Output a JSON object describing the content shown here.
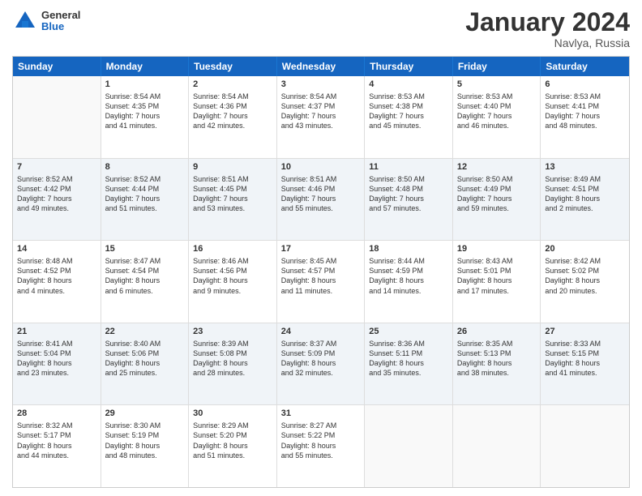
{
  "header": {
    "logo": {
      "general": "General",
      "blue": "Blue"
    },
    "title": "January 2024",
    "subtitle": "Navlya, Russia"
  },
  "calendar": {
    "days": [
      "Sunday",
      "Monday",
      "Tuesday",
      "Wednesday",
      "Thursday",
      "Friday",
      "Saturday"
    ],
    "rows": [
      [
        {
          "day": "",
          "lines": [],
          "empty": true
        },
        {
          "day": "1",
          "lines": [
            "Sunrise: 8:54 AM",
            "Sunset: 4:35 PM",
            "Daylight: 7 hours",
            "and 41 minutes."
          ]
        },
        {
          "day": "2",
          "lines": [
            "Sunrise: 8:54 AM",
            "Sunset: 4:36 PM",
            "Daylight: 7 hours",
            "and 42 minutes."
          ]
        },
        {
          "day": "3",
          "lines": [
            "Sunrise: 8:54 AM",
            "Sunset: 4:37 PM",
            "Daylight: 7 hours",
            "and 43 minutes."
          ]
        },
        {
          "day": "4",
          "lines": [
            "Sunrise: 8:53 AM",
            "Sunset: 4:38 PM",
            "Daylight: 7 hours",
            "and 45 minutes."
          ]
        },
        {
          "day": "5",
          "lines": [
            "Sunrise: 8:53 AM",
            "Sunset: 4:40 PM",
            "Daylight: 7 hours",
            "and 46 minutes."
          ]
        },
        {
          "day": "6",
          "lines": [
            "Sunrise: 8:53 AM",
            "Sunset: 4:41 PM",
            "Daylight: 7 hours",
            "and 48 minutes."
          ]
        }
      ],
      [
        {
          "day": "7",
          "lines": [
            "Sunrise: 8:52 AM",
            "Sunset: 4:42 PM",
            "Daylight: 7 hours",
            "and 49 minutes."
          ]
        },
        {
          "day": "8",
          "lines": [
            "Sunrise: 8:52 AM",
            "Sunset: 4:44 PM",
            "Daylight: 7 hours",
            "and 51 minutes."
          ]
        },
        {
          "day": "9",
          "lines": [
            "Sunrise: 8:51 AM",
            "Sunset: 4:45 PM",
            "Daylight: 7 hours",
            "and 53 minutes."
          ]
        },
        {
          "day": "10",
          "lines": [
            "Sunrise: 8:51 AM",
            "Sunset: 4:46 PM",
            "Daylight: 7 hours",
            "and 55 minutes."
          ]
        },
        {
          "day": "11",
          "lines": [
            "Sunrise: 8:50 AM",
            "Sunset: 4:48 PM",
            "Daylight: 7 hours",
            "and 57 minutes."
          ]
        },
        {
          "day": "12",
          "lines": [
            "Sunrise: 8:50 AM",
            "Sunset: 4:49 PM",
            "Daylight: 7 hours",
            "and 59 minutes."
          ]
        },
        {
          "day": "13",
          "lines": [
            "Sunrise: 8:49 AM",
            "Sunset: 4:51 PM",
            "Daylight: 8 hours",
            "and 2 minutes."
          ]
        }
      ],
      [
        {
          "day": "14",
          "lines": [
            "Sunrise: 8:48 AM",
            "Sunset: 4:52 PM",
            "Daylight: 8 hours",
            "and 4 minutes."
          ]
        },
        {
          "day": "15",
          "lines": [
            "Sunrise: 8:47 AM",
            "Sunset: 4:54 PM",
            "Daylight: 8 hours",
            "and 6 minutes."
          ]
        },
        {
          "day": "16",
          "lines": [
            "Sunrise: 8:46 AM",
            "Sunset: 4:56 PM",
            "Daylight: 8 hours",
            "and 9 minutes."
          ]
        },
        {
          "day": "17",
          "lines": [
            "Sunrise: 8:45 AM",
            "Sunset: 4:57 PM",
            "Daylight: 8 hours",
            "and 11 minutes."
          ]
        },
        {
          "day": "18",
          "lines": [
            "Sunrise: 8:44 AM",
            "Sunset: 4:59 PM",
            "Daylight: 8 hours",
            "and 14 minutes."
          ]
        },
        {
          "day": "19",
          "lines": [
            "Sunrise: 8:43 AM",
            "Sunset: 5:01 PM",
            "Daylight: 8 hours",
            "and 17 minutes."
          ]
        },
        {
          "day": "20",
          "lines": [
            "Sunrise: 8:42 AM",
            "Sunset: 5:02 PM",
            "Daylight: 8 hours",
            "and 20 minutes."
          ]
        }
      ],
      [
        {
          "day": "21",
          "lines": [
            "Sunrise: 8:41 AM",
            "Sunset: 5:04 PM",
            "Daylight: 8 hours",
            "and 23 minutes."
          ]
        },
        {
          "day": "22",
          "lines": [
            "Sunrise: 8:40 AM",
            "Sunset: 5:06 PM",
            "Daylight: 8 hours",
            "and 25 minutes."
          ]
        },
        {
          "day": "23",
          "lines": [
            "Sunrise: 8:39 AM",
            "Sunset: 5:08 PM",
            "Daylight: 8 hours",
            "and 28 minutes."
          ]
        },
        {
          "day": "24",
          "lines": [
            "Sunrise: 8:37 AM",
            "Sunset: 5:09 PM",
            "Daylight: 8 hours",
            "and 32 minutes."
          ]
        },
        {
          "day": "25",
          "lines": [
            "Sunrise: 8:36 AM",
            "Sunset: 5:11 PM",
            "Daylight: 8 hours",
            "and 35 minutes."
          ]
        },
        {
          "day": "26",
          "lines": [
            "Sunrise: 8:35 AM",
            "Sunset: 5:13 PM",
            "Daylight: 8 hours",
            "and 38 minutes."
          ]
        },
        {
          "day": "27",
          "lines": [
            "Sunrise: 8:33 AM",
            "Sunset: 5:15 PM",
            "Daylight: 8 hours",
            "and 41 minutes."
          ]
        }
      ],
      [
        {
          "day": "28",
          "lines": [
            "Sunrise: 8:32 AM",
            "Sunset: 5:17 PM",
            "Daylight: 8 hours",
            "and 44 minutes."
          ]
        },
        {
          "day": "29",
          "lines": [
            "Sunrise: 8:30 AM",
            "Sunset: 5:19 PM",
            "Daylight: 8 hours",
            "and 48 minutes."
          ]
        },
        {
          "day": "30",
          "lines": [
            "Sunrise: 8:29 AM",
            "Sunset: 5:20 PM",
            "Daylight: 8 hours",
            "and 51 minutes."
          ]
        },
        {
          "day": "31",
          "lines": [
            "Sunrise: 8:27 AM",
            "Sunset: 5:22 PM",
            "Daylight: 8 hours",
            "and 55 minutes."
          ]
        },
        {
          "day": "",
          "lines": [],
          "empty": true
        },
        {
          "day": "",
          "lines": [],
          "empty": true
        },
        {
          "day": "",
          "lines": [],
          "empty": true
        }
      ]
    ]
  }
}
